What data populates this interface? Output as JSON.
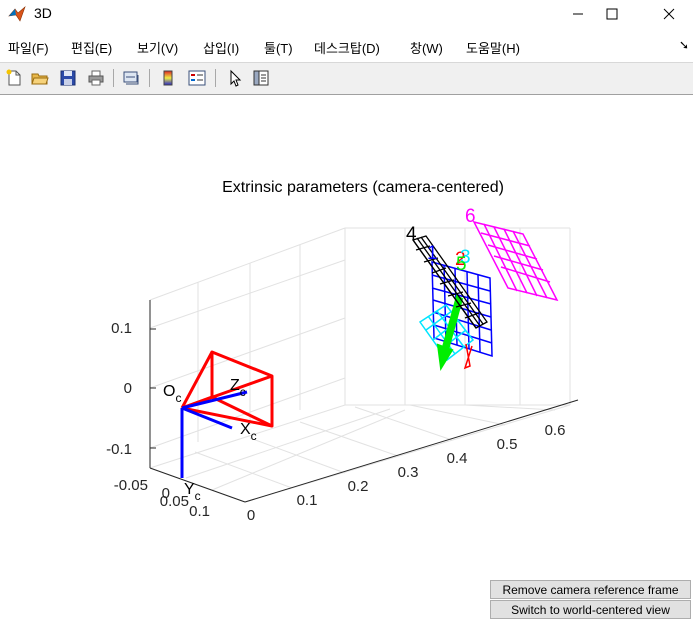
{
  "window": {
    "title": "3D",
    "controls": {
      "minimize": "—",
      "maximize": "☐",
      "close": "✕"
    }
  },
  "menu": [
    {
      "label": "파일(F)"
    },
    {
      "label": "편집(E)"
    },
    {
      "label": "보기(V)"
    },
    {
      "label": "삽입(I)"
    },
    {
      "label": "툴(T)"
    },
    {
      "label": "데스크탑(D)"
    },
    {
      "label": "창(W)"
    },
    {
      "label": "도움말(H)"
    }
  ],
  "toolbar": {
    "icons": [
      "new-figure-icon",
      "open-file-icon",
      "save-icon",
      "print-icon",
      "link-plot-icon",
      "insert-colorbar-icon",
      "insert-legend-icon",
      "edit-plot-icon",
      "property-inspector-icon"
    ]
  },
  "plot": {
    "title": "Extrinsic parameters (camera-centered)",
    "z_ticks": [
      "0.1",
      "0",
      "-0.1"
    ],
    "y_ticks": [
      "-0.05",
      "0",
      "0.05",
      "0.1"
    ],
    "x_ticks": [
      "0",
      "0.1",
      "0.2",
      "0.3",
      "0.4",
      "0.5",
      "0.6"
    ],
    "camera_frame": {
      "origin": "O",
      "x_axis": "X",
      "y_axis": "Y",
      "z_axis": "Z",
      "subscript": "c"
    },
    "pattern_labels": [
      {
        "label": "1",
        "color": "#0000ff"
      },
      {
        "label": "2",
        "color": "#ff0000"
      },
      {
        "label": "3",
        "color": "#00ffff"
      },
      {
        "label": "4",
        "color": "#000000"
      },
      {
        "label": "5",
        "color": "#00ff00"
      },
      {
        "label": "6",
        "color": "#ff00ff"
      }
    ]
  },
  "buttons": {
    "remove_frame": "Remove camera reference frame",
    "switch_view": "Switch to world-centered view"
  }
}
